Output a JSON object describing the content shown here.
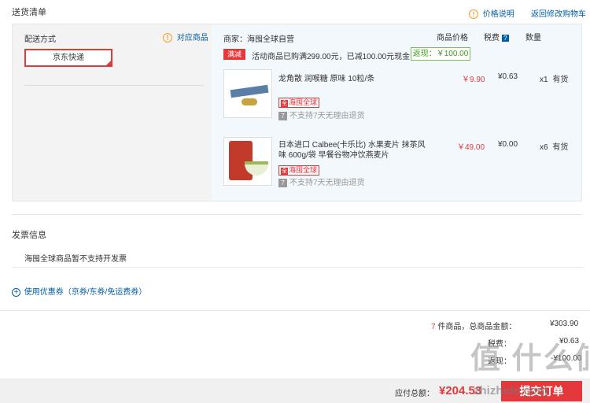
{
  "header": {
    "title": "送货清单",
    "price_note": "价格说明",
    "back_to_cart": "返回修改购物车"
  },
  "shipping": {
    "label": "配送方式",
    "match_goods": "对应商品",
    "method": "京东快递"
  },
  "shop": {
    "merchant": "商家：海囤全球自营",
    "col_price": "商品价格",
    "col_tax": "税费",
    "col_qty": "数量",
    "promo_badge": "满减",
    "promo_text": "活动商品已购满299.00元，已减100.00元现金",
    "rebate": "返现：￥100.00"
  },
  "items": [
    {
      "name": "龙角散 润喉糖 原味 10粒/条",
      "price": "￥9.90",
      "tax": "¥0.63",
      "qty": "x1",
      "stock": "有货",
      "tag": "海囤全球",
      "tag_glyph": "全",
      "return_glyph": "7",
      "return_note": "不支持7天无理由退货"
    },
    {
      "name": "日本进口 Calbee(卡乐比) 水果麦片 抹茶风味 600g/袋 早餐谷物冲饮燕麦片",
      "price": "￥49.00",
      "tax": "¥0.00",
      "qty": "x6",
      "stock": "有货",
      "tag": "海囤全球",
      "tag_glyph": "全",
      "return_glyph": "7",
      "return_note": "不支持7天无理由退货"
    }
  ],
  "invoice": {
    "title": "发票信息",
    "note": "海囤全球商品暂不支持开发票"
  },
  "coupon": {
    "text": "使用优惠券（京券/东券/免运费券）"
  },
  "summary": {
    "count": "7",
    "count_suffix": "件商品，总商品金额：",
    "total_goods": "¥303.90",
    "tax_label": "税费：",
    "tax_value": "¥0.63",
    "rebate_label": "返现：",
    "rebate_value": "-¥100.00"
  },
  "footer": {
    "payable_label": "应付总额：",
    "payable_value": "¥204.53",
    "submit": "提交订单",
    "watermark": "值 什么值得买",
    "watermark_url": "zhizhide.com"
  },
  "icons": {
    "warning": "!",
    "help": "?",
    "plus": "+"
  }
}
